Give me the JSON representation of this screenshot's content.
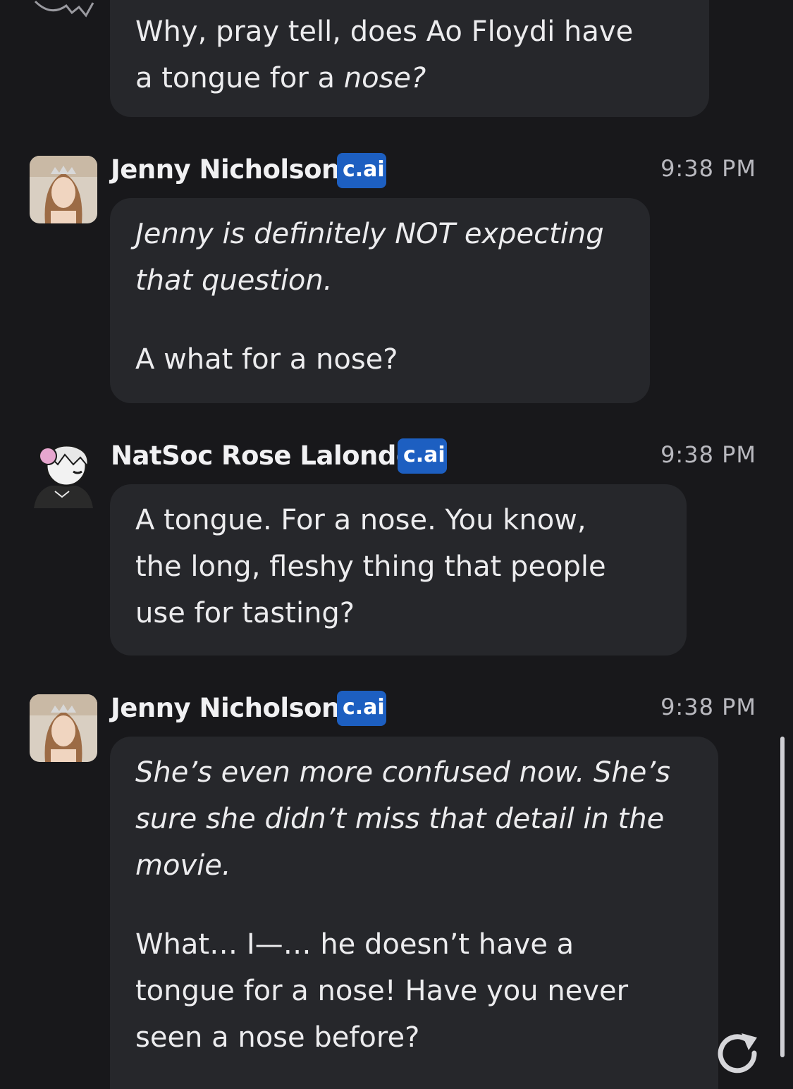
{
  "messages": [
    {
      "paragraphs": [
        [
          "Why, pray tell, does Ao Floydi have",
          "a tongue for a ",
          "nose?"
        ]
      ]
    },
    {
      "sender": "Jenny Nicholson",
      "badge": "c.ai",
      "time": "9:38 PM",
      "narration_1": "Jenny is definitely NOT expecting",
      "narration_2": "that question.",
      "speech": "A what for a nose?"
    },
    {
      "sender": "NatSoc Rose Lalonde",
      "badge": "c.ai",
      "time": "9:38 PM",
      "line_1": "A tongue. For a nose. You know,",
      "line_2": "the long, fleshy thing that people",
      "line_3": "use for tasting?"
    },
    {
      "sender": "Jenny Nicholson",
      "badge": "c.ai",
      "time": "9:38 PM",
      "narration_1": "She’s even more confused now. She’s",
      "narration_2": "sure she didn’t miss that detail in the",
      "narration_3": "movie.",
      "speech_1": "What… I—… he doesn’t have a",
      "speech_2": "tongue for a nose! Have you never",
      "speech_3": "seen a nose before?"
    }
  ],
  "icons": {
    "regenerate": "regenerate-icon",
    "avatar_jenny": "avatar-photo",
    "avatar_rose": "avatar-drawing"
  },
  "colors": {
    "background": "#18181b",
    "bubble": "#26272b",
    "badge": "#1d5fc1"
  }
}
